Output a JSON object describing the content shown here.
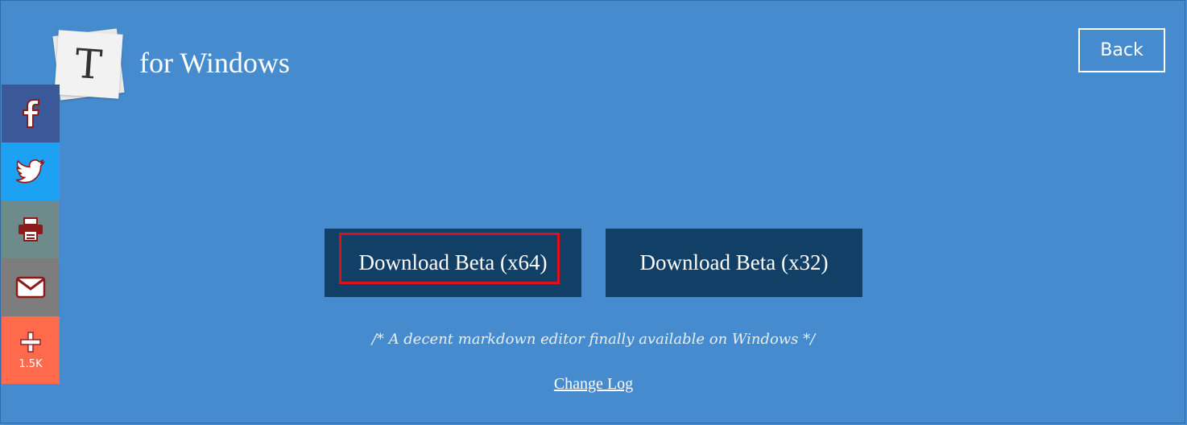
{
  "header": {
    "logo_letter": "T",
    "app_title": "for Windows",
    "back_label": "Back"
  },
  "social": {
    "items": [
      {
        "name": "facebook",
        "icon": "facebook-icon",
        "color": "#3b5998"
      },
      {
        "name": "twitter",
        "icon": "twitter-icon",
        "color": "#1da1f2"
      },
      {
        "name": "print",
        "icon": "printer-icon",
        "color": "#6f8a8a"
      },
      {
        "name": "email",
        "icon": "email-icon",
        "color": "#7d7d7d"
      },
      {
        "name": "more",
        "icon": "plus-icon",
        "color": "#ff6a4d"
      }
    ],
    "share_count": "1.5K"
  },
  "main": {
    "download_x64_label": "Download Beta (x64)",
    "download_x32_label": "Download Beta (x32)",
    "tagline": "/* A decent markdown editor finally available on Windows */",
    "changelog_label": "Change Log"
  },
  "colors": {
    "background": "#458bcd",
    "button": "#123f66",
    "highlight": "#e0101a",
    "icon_red": "#8b1a1a"
  }
}
